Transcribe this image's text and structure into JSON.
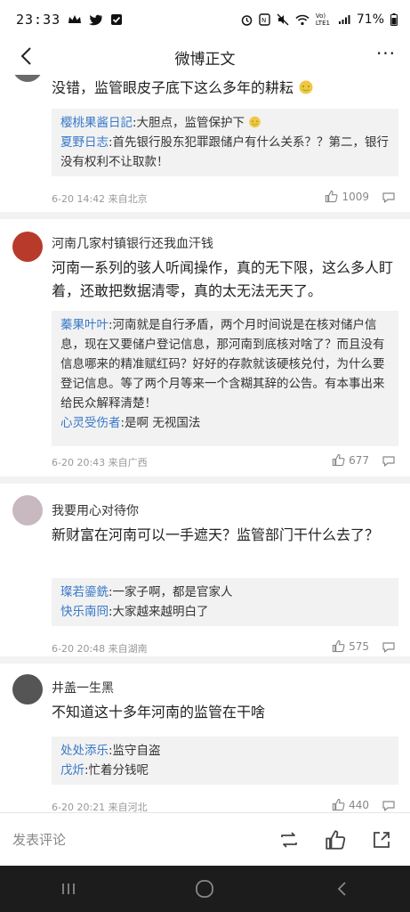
{
  "status_bar": {
    "time": "23:33",
    "battery": "71%",
    "network_label": "Vo) LTE1"
  },
  "nav": {
    "title": "微博正文"
  },
  "comments": [
    {
      "text": "没错，监管眼皮子底下这么多年的耕耘",
      "replies": [
        {
          "user": "樱桃果酱日記",
          "text": ":大胆点，监管保护下"
        },
        {
          "user": "夏野日志",
          "text": ":首先银行股东犯罪跟储户有什么关系？？第二，银行没有权利不让取款！"
        }
      ],
      "meta": "6-20 14:42 来自北京",
      "likes": "1009"
    },
    {
      "username": "河南几家村镇银行还我血汗钱",
      "text": "河南一系列的骇人听闻操作，真的无下限，这么多人盯着，还敢把数据清零，真的太无法无天了。",
      "replies": [
        {
          "user": "蓁果叶叶",
          "text": ":河南就是自行矛盾，两个月时间说是在核对储户信息，现在又要储户登记信息，那河南到底核对啥了？而且没有信息哪来的精准赋红码？好好的存款就该硬核兑付，为什么要登记信息。等了两个月等来一个含糊其辞的公告。有本事出来给民众解释清楚！"
        },
        {
          "user": "心灵受伤者",
          "text": ":是啊 无视国法"
        }
      ],
      "meta": "6-20 20:43 来自广西",
      "likes": "677"
    },
    {
      "username": "我要用心对待你",
      "text": "新财富在河南可以一手遮天？监管部门干什么去了？",
      "replies": [
        {
          "user": "璨若鎏銑",
          "text": ":一家子啊，都是官家人"
        },
        {
          "user": "快乐南冏",
          "text": ":大家越来越明白了"
        }
      ],
      "meta": "6-20 20:48 来自湖南",
      "likes": "575"
    },
    {
      "username": "井盖一生黑",
      "text": "不知道这十多年河南的监管在干啥",
      "replies": [
        {
          "user": "处处添乐",
          "text": ":监守自盗"
        },
        {
          "user": "戊炘",
          "text": ":忙着分钱呢"
        }
      ],
      "meta": "6-20 20:21 来自河北",
      "likes": "440"
    }
  ],
  "bottom_bar": {
    "compose_placeholder": "发表评论"
  },
  "colors": {
    "link_blue": "#3778c8",
    "page_bg": "#f2f2f2",
    "card_bg": "#ffffff",
    "meta_gray": "#999999"
  },
  "icons": {
    "back": "chevron-left-icon",
    "more": "more-dots-icon",
    "like": "thumbs-up-icon",
    "reply": "speech-bubble-icon",
    "repost": "repost-icon",
    "share": "share-icon"
  }
}
